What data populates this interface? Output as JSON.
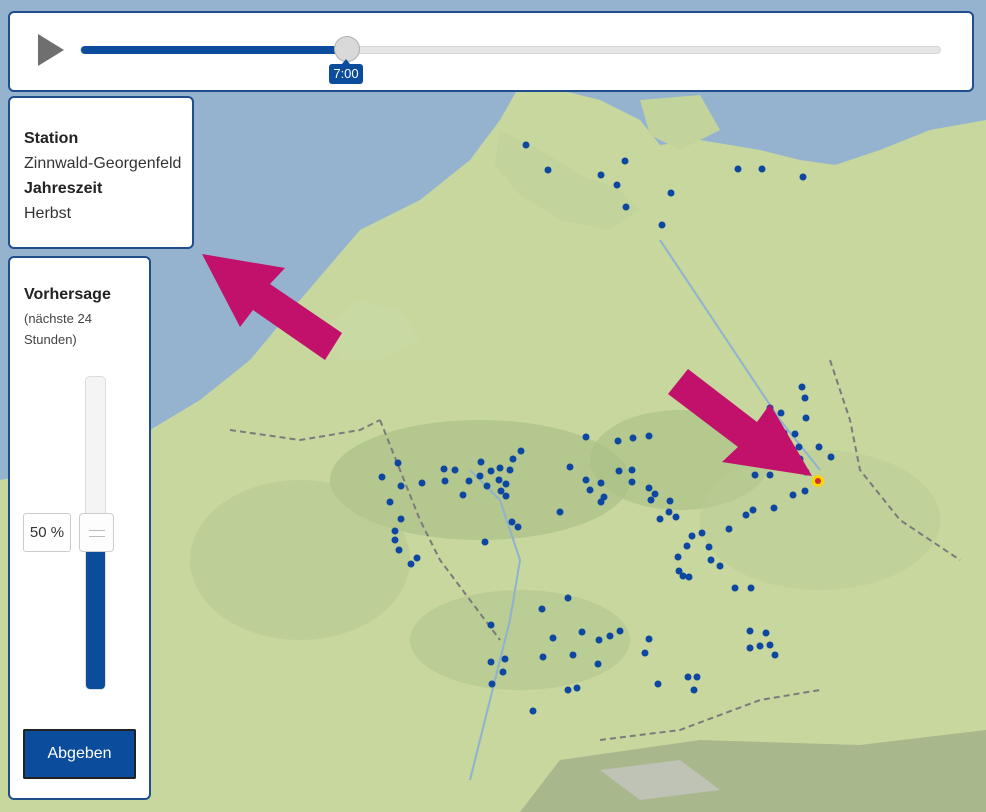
{
  "time_slider": {
    "current_time": "7:00",
    "progress": 0.309
  },
  "station_info": {
    "station_label": "Station",
    "station_value": "Zinnwald-Georgenfeld",
    "season_label": "Jahreszeit",
    "season_value": "Herbst"
  },
  "forecast": {
    "title": "Vorhersage",
    "subtitle": "(nächste 24 Stunden)",
    "percent_text": "50 %",
    "value": 0.5,
    "submit_label": "Abgeben"
  },
  "colors": {
    "accent": "#0b4c9c",
    "panel_border": "#1f4e8c",
    "arrow": "#c2116b",
    "station_dot": "#0d47a1",
    "selected_station": "#ffd400"
  },
  "icons": {
    "play": "play-icon",
    "arrows": "annotation-arrow"
  }
}
